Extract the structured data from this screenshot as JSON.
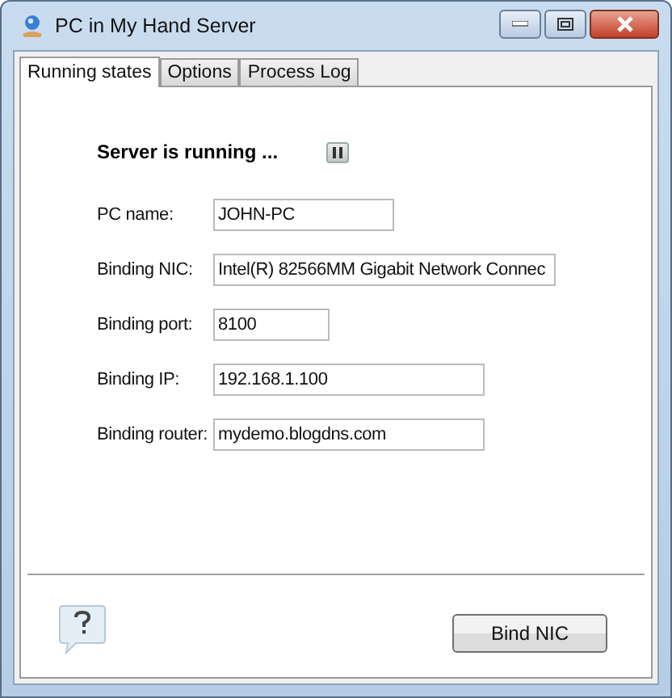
{
  "window": {
    "title": "PC in My Hand Server"
  },
  "tabs": [
    {
      "label": "Running states",
      "selected": true
    },
    {
      "label": "Options",
      "selected": false
    },
    {
      "label": "Process Log",
      "selected": false
    }
  ],
  "status": {
    "text": "Server is running ...",
    "running": true
  },
  "fields": [
    {
      "label": "PC name:",
      "value": "JOHN-PC"
    },
    {
      "label": "Binding NIC:",
      "value": "Intel(R) 82566MM Gigabit Network Connec"
    },
    {
      "label": "Binding port:",
      "value": "8100"
    },
    {
      "label": "Binding IP:",
      "value": "192.168.1.100"
    },
    {
      "label": "Binding router:",
      "value": "mydemo.blogdns.com"
    }
  ],
  "buttons": [
    {
      "label": "Bind NIC"
    }
  ]
}
